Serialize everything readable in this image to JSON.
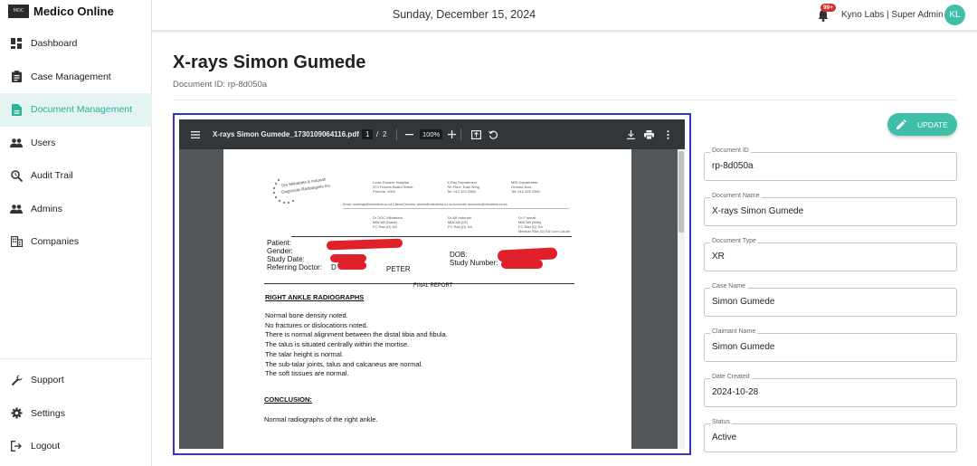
{
  "brand": {
    "logo_text": "MDC",
    "name": "Medico Online"
  },
  "sidebar": {
    "items": [
      {
        "label": "Dashboard",
        "icon": "dashboard-icon"
      },
      {
        "label": "Case Management",
        "icon": "clipboard-icon"
      },
      {
        "label": "Document Management",
        "icon": "document-icon",
        "active": true
      },
      {
        "label": "Users",
        "icon": "users-icon"
      },
      {
        "label": "Audit Trail",
        "icon": "search-history-icon"
      },
      {
        "label": "Admins",
        "icon": "admins-icon"
      },
      {
        "label": "Companies",
        "icon": "building-icon"
      }
    ],
    "bottom_items": [
      {
        "label": "Support",
        "icon": "wrench-icon"
      },
      {
        "label": "Settings",
        "icon": "gear-icon"
      },
      {
        "label": "Logout",
        "icon": "logout-icon"
      }
    ]
  },
  "header": {
    "date": "Sunday, December 15, 2024",
    "notification_count": "99+",
    "user_label": "Kyno Labs | Super Admin",
    "avatar_initials": "KL"
  },
  "page": {
    "title": "X-rays Simon Gumede",
    "document_id_line": "Document ID: rp-8d050a"
  },
  "viewer": {
    "filename": "X-rays Simon Gumede_1730109064116.pdf",
    "current_page": "1",
    "page_separator": "/",
    "total_pages": "2",
    "zoom": "100%",
    "report": {
      "hospital_left": [
        "Louis Pasteur Hospital",
        "374 Francis Baard Street",
        "Pretoria, 0002"
      ],
      "hospital_mid": [
        "X-Ray Department",
        "7th Floor, East Wing",
        "Tel: 012 320 2980"
      ],
      "hospital_right": [
        "MRI Department",
        "Ground floor",
        "Tel: 012 320 2980"
      ],
      "practice_logo": [
        "Drs Mkhabela & Indunah",
        "Diagnostic Radiologists Inc."
      ],
      "email_line": "Email: bookings@mkhabela.co.za   Clients/Queries: clients@mkhabela.co.za   Accounts: accounts@mkhabela.co.za",
      "doctors_1": [
        "Dr DOC Mkhabela",
        "MBChB (Natal)",
        "FC Rad (D) SA"
      ],
      "doctors_2": [
        "Dr AB Indunah",
        "MBChB (Ot)",
        "FC Rad (D) SA"
      ],
      "doctors_3": [
        "Dr F Ismail",
        "MBChB (Wits)",
        "FC Rad (D) SA",
        "Medical Rad (D) SA Cum Laude"
      ],
      "patient_label": "Patient:",
      "gender_label": "Gender:",
      "study_date_label": "Study Date:",
      "referring_label": "Referring Doctor:",
      "referring_partial_start": "D",
      "referring_partial_end": "PETER",
      "dob_label": "DOB:",
      "study_number_label": "Study Number:",
      "final_report": "FINAL REPORT",
      "section_title": "RIGHT ANKLE RADIOGRAPHS",
      "findings": [
        "Normal bone density noted.",
        "No fractures or dislocations noted.",
        "There is normal alignment between the distal tibia and fibula.",
        "The talus is situated centrally within the mortise.",
        "The talar height is normal.",
        "The sub-talar joints, talus and calcaneus are normal.",
        "The soft tissues are normal."
      ],
      "conclusion_title": "CONCLUSION:",
      "conclusion_text": "Normal radiographs of the right ankle."
    }
  },
  "form": {
    "update_label": "UPDATE",
    "fields": [
      {
        "label": "Document ID",
        "value": "rp-8d050a"
      },
      {
        "label": "Document Name",
        "value": "X-rays Simon Gumede"
      },
      {
        "label": "Document Type",
        "value": "XR"
      },
      {
        "label": "Case Name",
        "value": "Simon Gumede"
      },
      {
        "label": "Claimant Name",
        "value": "Simon Gumede"
      },
      {
        "label": "Date Created",
        "value": "2024-10-28"
      },
      {
        "label": "Status",
        "value": "Active"
      }
    ]
  },
  "colors": {
    "accent": "#3fbfa8",
    "active_bg": "#e3f4f2",
    "active_text": "#2bb09a",
    "viewer_border": "#3333cc",
    "badge": "#d32f2f",
    "redaction": "#e0202a"
  }
}
